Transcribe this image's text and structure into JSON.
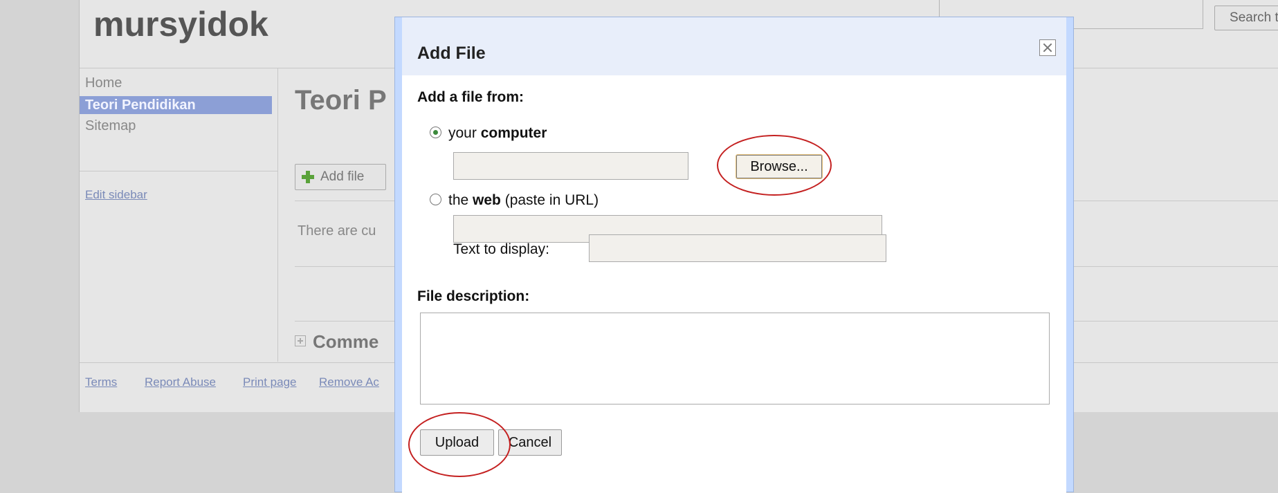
{
  "site": {
    "title": "mursyidok",
    "search_button": "Search this site"
  },
  "sidebar": {
    "items": [
      {
        "label": "Home",
        "active": false
      },
      {
        "label": "Teori Pendidikan",
        "active": true
      },
      {
        "label": "Sitemap",
        "active": false
      }
    ],
    "edit_link": "Edit sidebar"
  },
  "main": {
    "page_title_visible": "Teori P",
    "add_file_button": "Add file",
    "attachments_text_visible": "There are cu",
    "comments_label_visible": "Comme"
  },
  "footer": {
    "links": [
      "Terms",
      "Report Abuse",
      "Print page",
      "Remove Ac"
    ]
  },
  "dialog": {
    "title": "Add File",
    "add_from_heading": "Add a file from:",
    "option_computer": {
      "prefix": "your ",
      "bold": "computer",
      "suffix": "",
      "checked": true
    },
    "browse_button": "Browse...",
    "option_web": {
      "prefix": "the ",
      "bold": "web",
      "suffix": " (paste in URL)",
      "checked": false
    },
    "text_to_display_label": "Text to display:",
    "file_description_heading": "File description:",
    "upload_button": "Upload",
    "cancel_button": "Cancel"
  },
  "colors": {
    "dialog_frame": "#c3d9ff",
    "dialog_titlebar": "#e8eefa",
    "active_nav": "#8c9fd6",
    "annotation": "#c42020"
  }
}
